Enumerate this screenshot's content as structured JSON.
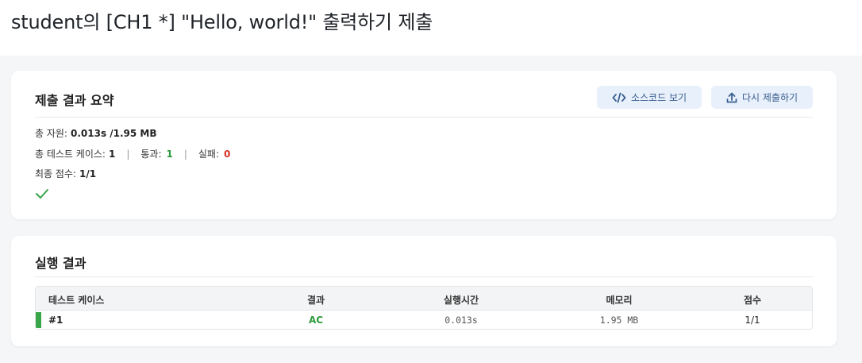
{
  "header": {
    "title": "student의 [CH1 *] \"Hello, world!\" 출력하기 제출"
  },
  "summary": {
    "heading": "제출 결과 요약",
    "view_source_label": "소스코드 보기",
    "resubmit_label": "다시 제출하기",
    "resource_label": "총 자원:",
    "resource_value": "0.013s /1.95 MB",
    "tests_label": "총 테스트 케이스:",
    "tests_value": "1",
    "separator": "|",
    "pass_label": "통과:",
    "pass_value": "1",
    "fail_label": "실패:",
    "fail_value": "0",
    "score_label": "최종 점수:",
    "score_value": "1/1",
    "status_icon": "check-icon"
  },
  "results": {
    "heading": "실행 결과",
    "columns": [
      "테스트 케이스",
      "결과",
      "실행시간",
      "메모리",
      "점수"
    ],
    "rows": [
      {
        "case": "#1",
        "result": "AC",
        "time": "0.013s",
        "memory": "1.95 MB",
        "score": "1/1"
      }
    ]
  },
  "colors": {
    "accent_button_bg": "#e8f0fb",
    "accent_button_text": "#3a5f8f",
    "pass": "#2e9a3d",
    "fail": "#d93025",
    "status_bar": "#3aa64a"
  }
}
